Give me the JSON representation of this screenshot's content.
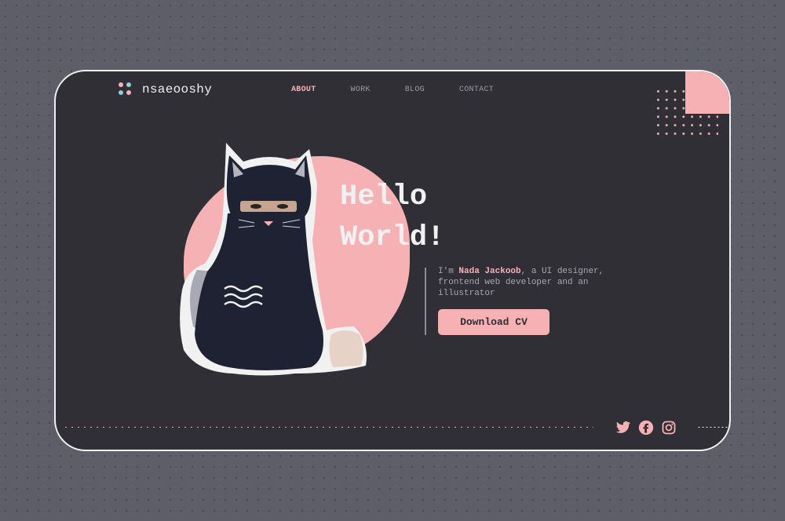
{
  "logo": {
    "text": "nsaeooshy"
  },
  "nav": [
    {
      "label": "ABOUT",
      "active": true
    },
    {
      "label": "WORK"
    },
    {
      "label": "BLOG"
    },
    {
      "label": "CONTACT"
    }
  ],
  "hero": {
    "title_line1": "Hello",
    "title_line2": "World!",
    "intro_prefix": "I'm ",
    "intro_name": "Nada Jackoob",
    "intro_rest": ", a UI designer, frontend web developer and an illustrator",
    "cta_label": "Download CV"
  },
  "social": [
    "twitter-icon",
    "facebook-icon",
    "instagram-icon"
  ],
  "colors": {
    "accent": "#f6b1b5",
    "card": "#2f2f35",
    "page": "#5e5e69",
    "teal": "#8ecfd8"
  }
}
